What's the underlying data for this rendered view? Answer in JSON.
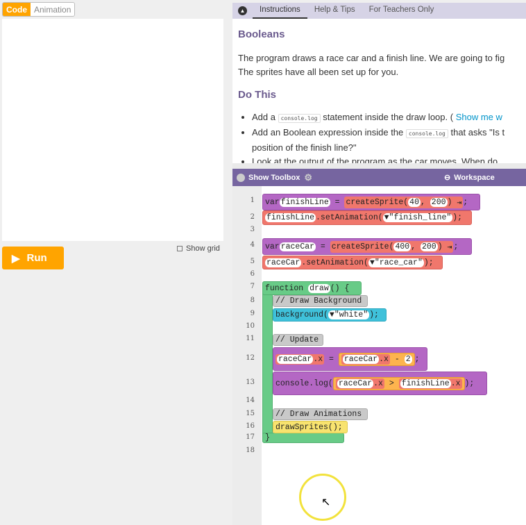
{
  "left": {
    "tabs": [
      "Code",
      "Animation"
    ],
    "run_label": "Run",
    "show_grid_label": "Show grid"
  },
  "instructions": {
    "tabs": [
      "Instructions",
      "Help & Tips",
      "For Teachers Only"
    ],
    "title": "Booleans",
    "intro_1": "The program draws a race car and a finish line. We are going to fig",
    "intro_2": "The sprites have all been set up for you.",
    "do_this": "Do This",
    "b1_pre": "Add a ",
    "b1_code": "console.log",
    "b1_post": " statement inside the draw loop. ( ",
    "b1_link": "Show me w",
    "b2_pre": "Add an Boolean expression inside the ",
    "b2_code": "console.log",
    "b2_post": " that asks \"Is t",
    "b2_line2": "position of the finish line?\"",
    "b3": "Look at the output of the program as the car moves. When do"
  },
  "workspace": {
    "show_toolbox": "Show Toolbox",
    "title": "Workspace",
    "line_numbers": [
      "1",
      "2",
      "3",
      "4",
      "5",
      "6",
      "7",
      "8",
      "9",
      "10",
      "11",
      "12",
      "13",
      "14",
      "15",
      "16",
      "17",
      "18"
    ],
    "code": {
      "var": "var",
      "finishLine": "finishLine",
      "raceCar": "raceCar",
      "eq": " = ",
      "createSprite": "createSprite(",
      "n40": "40",
      "n400": "400",
      "n200": "200",
      "close": ")",
      "semi": ";",
      "setAnim": ".setAnimation(",
      "finish_line": "▼\"finish_line\"",
      "race_car": "▼\"race_car\"",
      "end": ");",
      "function": "function ",
      "draw": "draw",
      "fn_rest": "() {",
      "c1": "// Draw Background",
      "background": "background(",
      "white": "▼\"white\"",
      "c2": "// Update",
      "dotx": ".x",
      "minus": " - ",
      "n2": "2",
      "console": "console.log(",
      "gt": " > ",
      "c3": "// Draw Animations",
      "drawSprites": "drawSprites();",
      "brace": "}"
    }
  }
}
